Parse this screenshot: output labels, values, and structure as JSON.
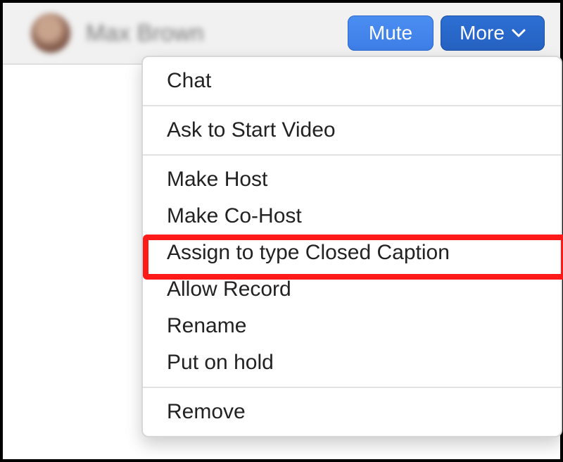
{
  "participant": {
    "name": "Max Brown"
  },
  "buttons": {
    "mute": "Mute",
    "more": "More"
  },
  "menu": {
    "sections": [
      {
        "items": [
          {
            "id": "chat",
            "label": "Chat"
          }
        ]
      },
      {
        "items": [
          {
            "id": "ask-start-video",
            "label": "Ask to Start Video"
          }
        ]
      },
      {
        "items": [
          {
            "id": "make-host",
            "label": "Make Host"
          },
          {
            "id": "make-co-host",
            "label": "Make Co-Host"
          },
          {
            "id": "assign-cc",
            "label": "Assign to type Closed Caption",
            "highlighted": true
          },
          {
            "id": "allow-record",
            "label": "Allow Record"
          },
          {
            "id": "rename",
            "label": "Rename"
          },
          {
            "id": "put-on-hold",
            "label": "Put on hold"
          }
        ]
      },
      {
        "items": [
          {
            "id": "remove",
            "label": "Remove"
          }
        ]
      }
    ]
  },
  "colors": {
    "button_primary": "#3d7ee6",
    "button_more": "#2561c0",
    "highlight": "#ff1a1a"
  }
}
